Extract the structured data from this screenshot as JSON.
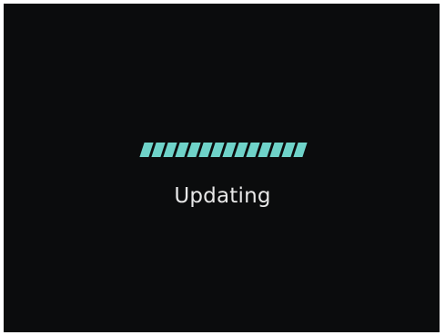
{
  "status": {
    "label": "Updating",
    "progress_icon": "striped-progress-bar"
  },
  "colors": {
    "background": "#0b0c0d",
    "accent": "#6fd3c9",
    "text": "#e8e8e8"
  }
}
